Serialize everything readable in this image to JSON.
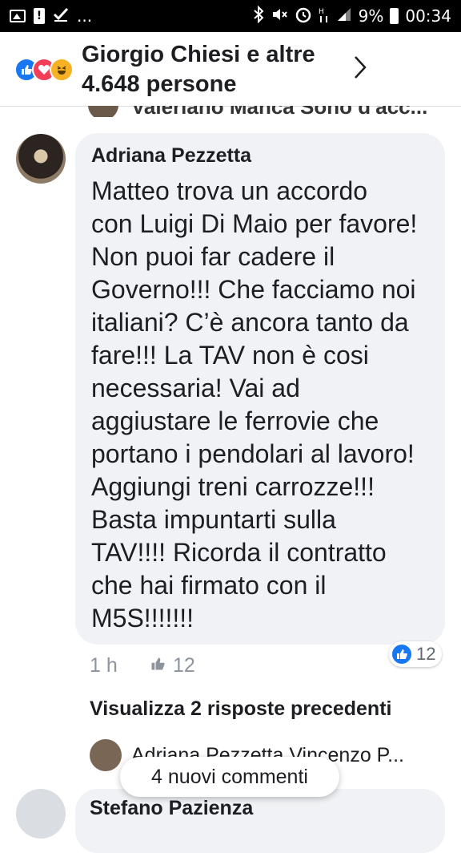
{
  "status_bar": {
    "battery": "9%",
    "time": "00:34",
    "ellipsis": "..."
  },
  "header": {
    "title": "Giorgio Chiesi e altre 4.648 persone",
    "reactions": [
      "like-icon",
      "love-icon",
      "haha-icon"
    ]
  },
  "cut_reply": {
    "text": "Valeriano Manca Sono d'acc..."
  },
  "comment": {
    "author": "Adriana Pezzetta",
    "text": "Matteo trova un accordo\ncon Luigi Di Maio per favore!\nNon puoi far cadere il\nGoverno!!! Che facciamo noi\nitaliani? C’è ancora tanto da\nfare!!! La TAV non è cosi\nnecessaria!  Vai ad\naggiustare le ferrovie che\nportano i pendolari al lavoro!\nAggiungi treni carrozze!!!\nBasta impuntarti sulla\nTAV!!!! Ricorda il contratto\nche hai firmato con il\nM5S!!!!!!!",
    "like_count": "12",
    "time": "1 h",
    "likes": "12"
  },
  "view_replies": "Visualizza 2 risposte precedenti",
  "reply_preview": "Adriana Pezzetta Vincenzo P...",
  "next_comment": {
    "author": "Stefano Pazienza"
  },
  "new_comments_pill": "4 nuovi commenti",
  "colors": {
    "facebook_blue": "#1877f2",
    "bubble_gray": "#f0f2f5",
    "meta_gray": "#8d949e"
  }
}
